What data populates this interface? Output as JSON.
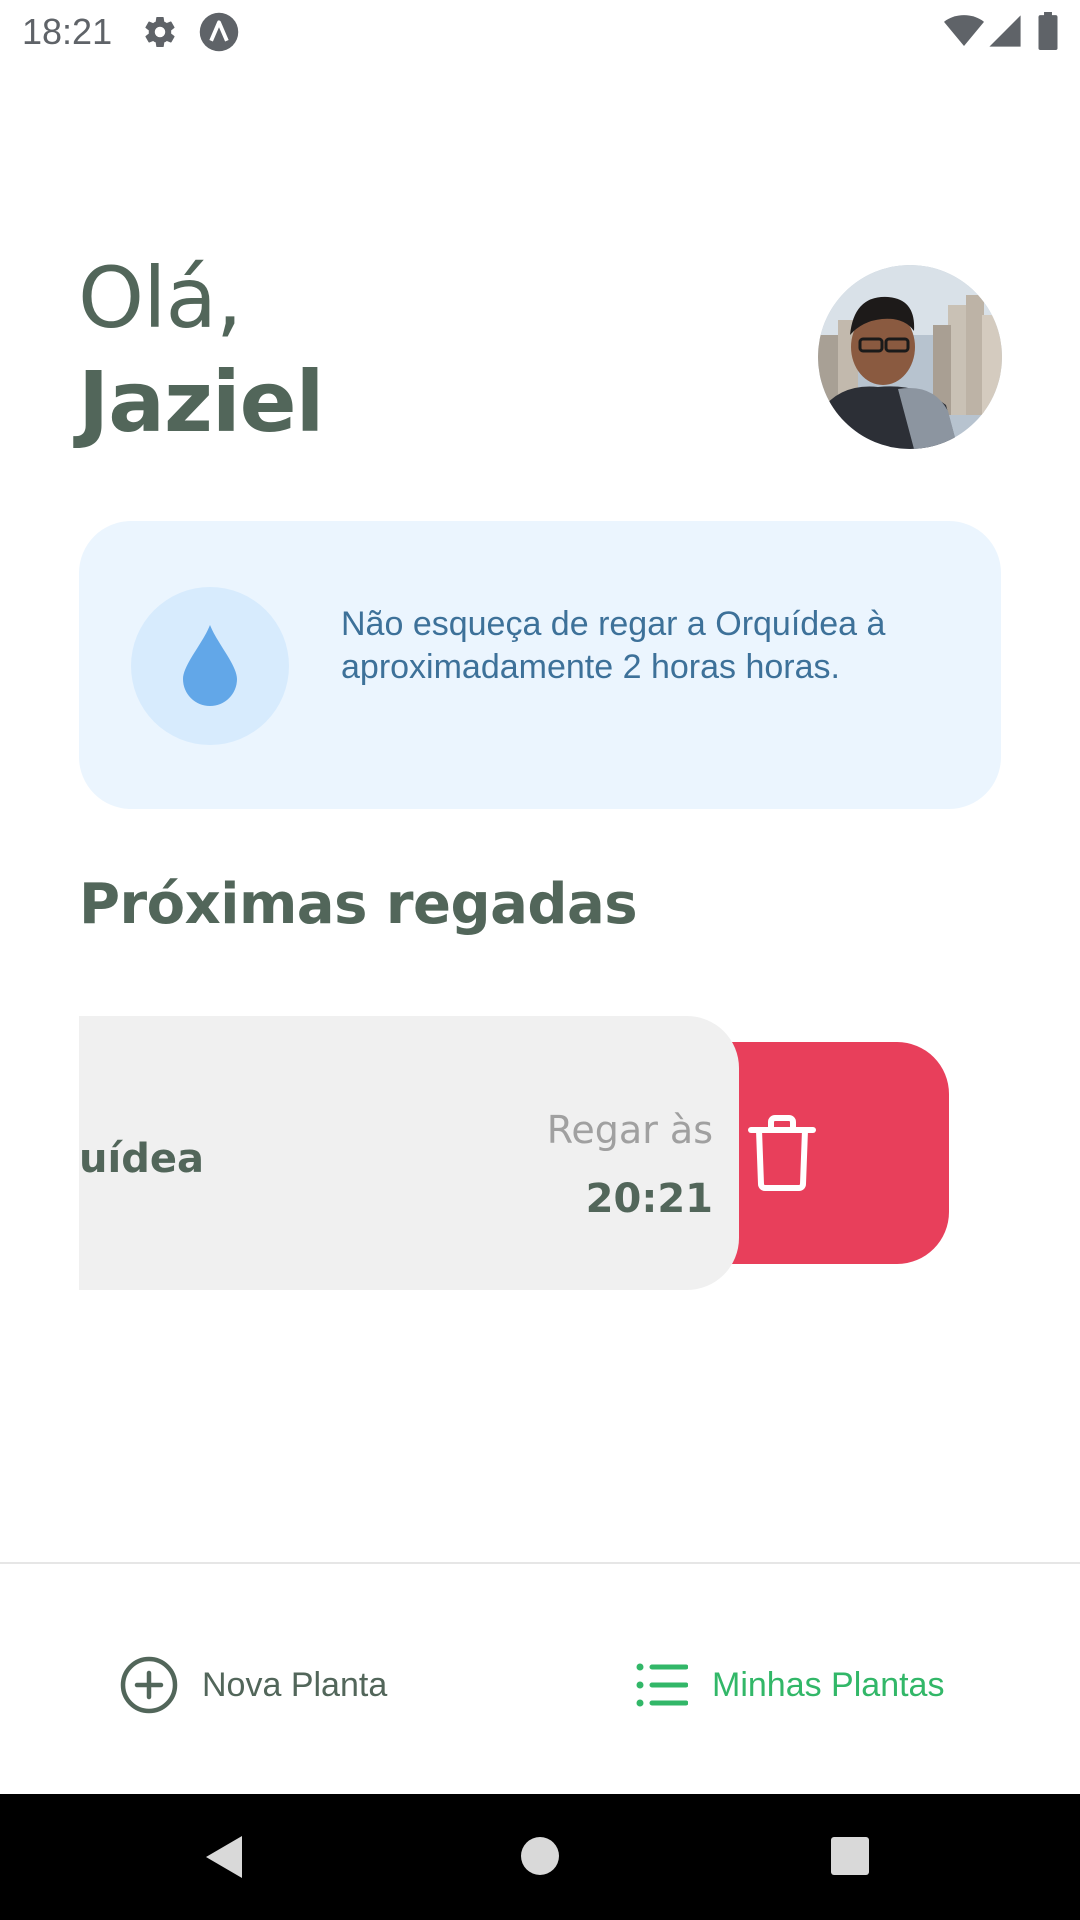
{
  "status_bar": {
    "time": "18:21",
    "icons": [
      "settings-icon",
      "a-letter-icon",
      "wifi-icon",
      "signal-icon",
      "battery-icon"
    ]
  },
  "header": {
    "greeting": "Olá,",
    "username": "Jaziel"
  },
  "tip": {
    "icon": "water-drop-icon",
    "text": "Não esqueça de regar a Orquídea à aproximadamente 2 horas horas."
  },
  "section": {
    "title": "Próximas regadas"
  },
  "plants": [
    {
      "name": "Orquídea",
      "visible_name": "uídea",
      "water_label": "Regar às",
      "water_time": "20:21",
      "delete_icon": "trash-icon"
    }
  ],
  "tabs": [
    {
      "label": "Nova Planta",
      "icon": "add-circle-icon",
      "active": false
    },
    {
      "label": "Minhas Plantas",
      "icon": "list-icon",
      "active": true
    }
  ],
  "colors": {
    "heading": "#52665a",
    "accent": "#32b768",
    "danger": "#e83f5b",
    "tip_bg": "#ebf5fe",
    "tip_text": "#3d7199",
    "drop": "#62a7e8"
  },
  "nav": {
    "buttons": [
      "back-icon",
      "home-icon",
      "recents-icon"
    ]
  }
}
